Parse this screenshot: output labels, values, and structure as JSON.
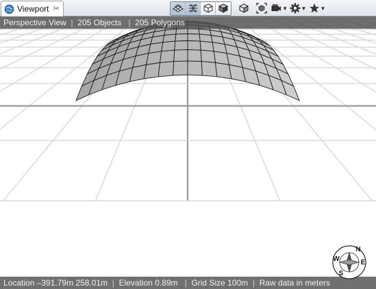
{
  "tab": {
    "title": "Viewport",
    "close_glyph": "✂"
  },
  "toolbar": {
    "groups": [
      "grid-view-icon",
      "wireframe-icon",
      "solid-cube-icon",
      "shaded-cube-icon"
    ],
    "buttons": [
      "cube-icon",
      "fit-view-icon",
      "camera-icon",
      "gear-icon",
      "star-icon"
    ]
  },
  "top_bar": {
    "view": "Perspective View",
    "objects": "205 Objects",
    "polygons": "205 Polygons"
  },
  "status_bar": {
    "location": "Location –391.79m 258.01m",
    "elevation": "Elevation 0.89m",
    "grid_size": "Grid Size 100m",
    "data_mode": "Raw data in meters"
  },
  "compass": {
    "n": "N",
    "e": "E",
    "s": "S",
    "w": "W"
  },
  "colors": {
    "background": "#ffffff",
    "grid": "#d8d8d8",
    "axis": "#9a9a9a",
    "surface": "#b8b8b8",
    "edge": "#1a1a1a"
  }
}
